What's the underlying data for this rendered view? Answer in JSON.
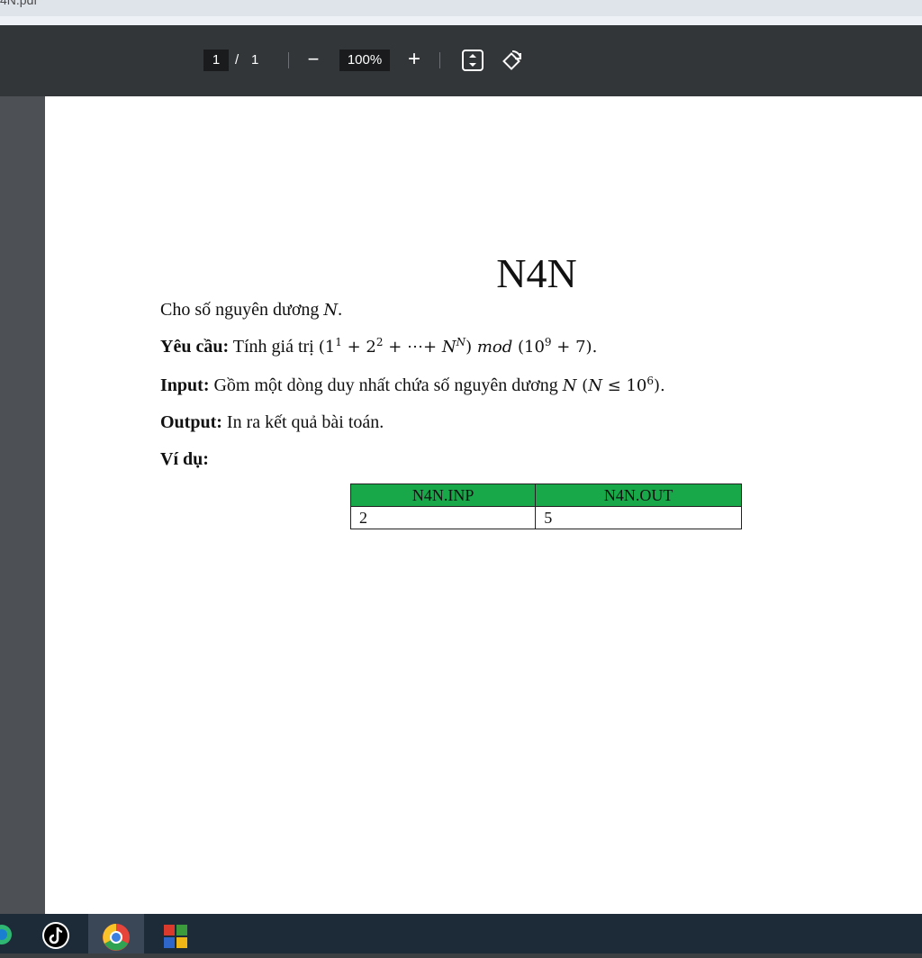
{
  "tab": {
    "title": "4N.pdf"
  },
  "toolbar": {
    "current_page": "1",
    "separator": "/",
    "total_pages": "1",
    "zoom_out_label": "−",
    "zoom_value": "100%",
    "zoom_in_label": "+",
    "icons": [
      "fit-page-icon",
      "rotate-icon"
    ]
  },
  "document": {
    "title": "N4N",
    "intro": "Cho số nguyên dương",
    "intro_var": "N",
    "intro_end": ".",
    "requirement": {
      "label": "Yêu cầu:",
      "text": "Tính giá trị"
    },
    "input": {
      "label": "Input:",
      "text": "Gồm một dòng duy nhất chứa số nguyên dương"
    },
    "output": {
      "label": "Output:",
      "text": "In ra kết quả bài toán."
    },
    "example_label": "Ví dụ:",
    "sample_table": {
      "headers": [
        "N4N.INP",
        "N4N.OUT"
      ],
      "rows": [
        [
          "2",
          "5"
        ]
      ]
    }
  },
  "taskbar": {
    "items": [
      "edge-icon",
      "tiktok-icon",
      "chrome-icon",
      "app-grid-icon"
    ]
  },
  "colors": {
    "toolbar": "#323639",
    "table_header": "#18a84a",
    "taskbar": "#1d2a38"
  }
}
